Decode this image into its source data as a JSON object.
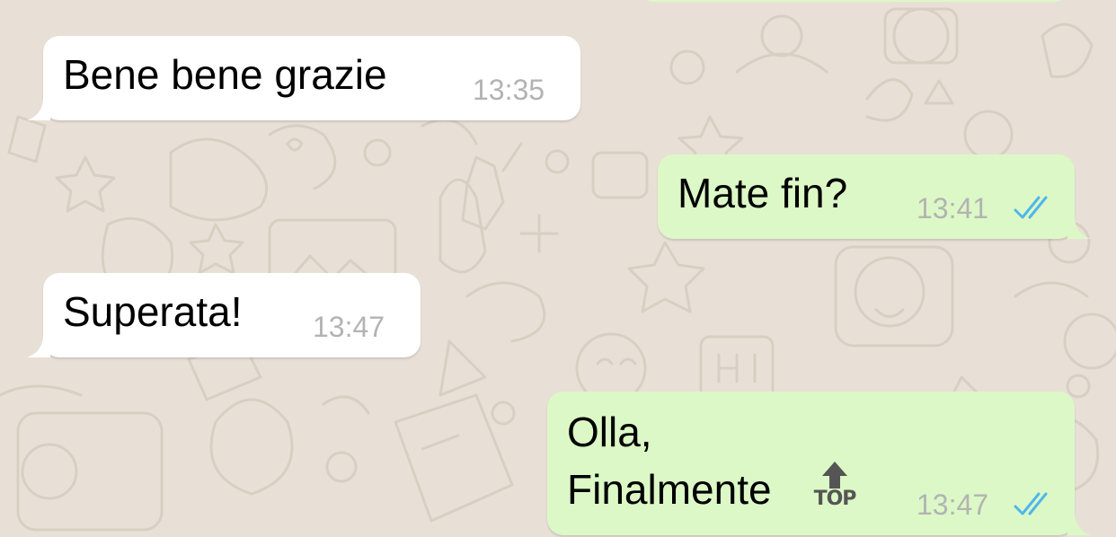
{
  "chat": {
    "messages": [
      {
        "direction": "incoming",
        "text": "Bene bene grazie",
        "time": "13:35"
      },
      {
        "direction": "outgoing",
        "text": "Mate fin?",
        "time": "13:41",
        "status": "read"
      },
      {
        "direction": "incoming",
        "text": "Superata!",
        "time": "13:47"
      },
      {
        "direction": "outgoing",
        "lines": [
          "Olla,",
          "Finalmente"
        ],
        "emoji": "top-arrow-emoji",
        "emoji_label": "TOP",
        "time": "13:47",
        "status": "read"
      }
    ]
  },
  "colors": {
    "background": "#e8e0d6",
    "incoming_bubble": "#ffffff",
    "outgoing_bubble": "#dcf8c6",
    "timestamp": "#b3b3b3",
    "read_ticks": "#4fb6ec"
  }
}
